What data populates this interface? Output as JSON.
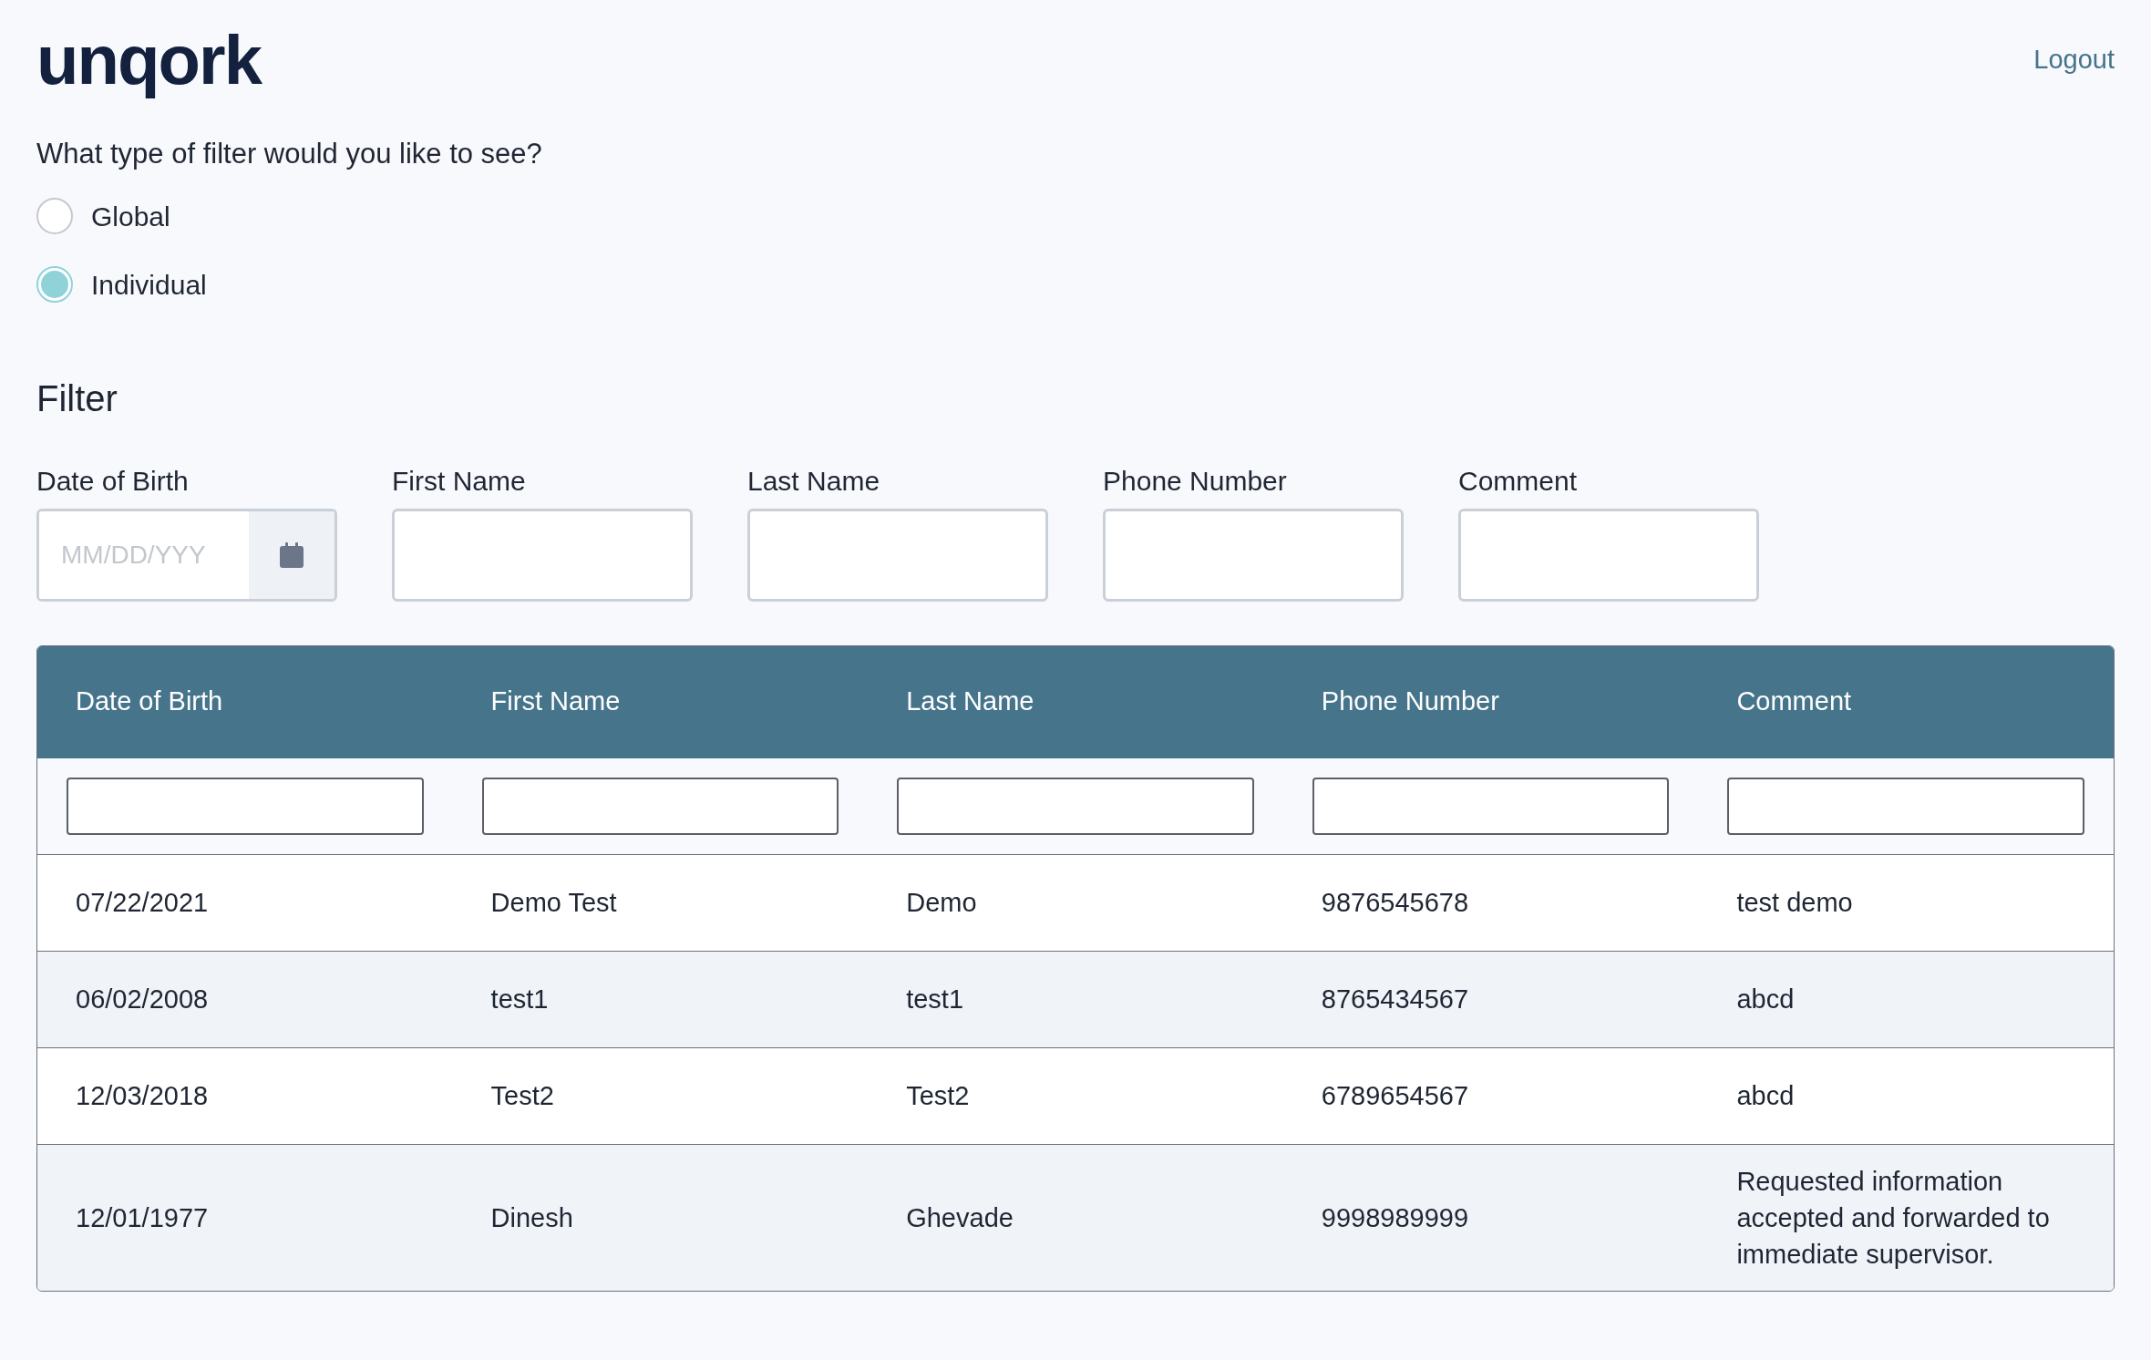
{
  "header": {
    "logo": "unqork",
    "logout": "Logout"
  },
  "filter_type": {
    "question": "What type of filter would you like to see?",
    "options": [
      {
        "label": "Global",
        "selected": false
      },
      {
        "label": "Individual",
        "selected": true
      }
    ]
  },
  "filter": {
    "title": "Filter",
    "fields": [
      {
        "label": "Date of Birth",
        "kind": "date",
        "placeholder": "MM/DD/YYY"
      },
      {
        "label": "First Name",
        "kind": "text"
      },
      {
        "label": "Last Name",
        "kind": "text"
      },
      {
        "label": "Phone Number",
        "kind": "text"
      },
      {
        "label": "Comment",
        "kind": "text"
      }
    ]
  },
  "table": {
    "columns": [
      "Date of Birth",
      "First Name",
      "Last Name",
      "Phone Number",
      "Comment"
    ],
    "rows": [
      [
        "07/22/2021",
        "Demo Test",
        "Demo",
        "9876545678",
        "test demo"
      ],
      [
        "06/02/2008",
        "test1",
        "test1",
        "8765434567",
        "abcd"
      ],
      [
        "12/03/2018",
        "Test2",
        "Test2",
        "6789654567",
        "abcd"
      ],
      [
        "12/01/1977",
        "Dinesh",
        "Ghevade",
        "9998989999",
        "Requested information accepted and forwarded to immediate supervisor."
      ]
    ]
  }
}
